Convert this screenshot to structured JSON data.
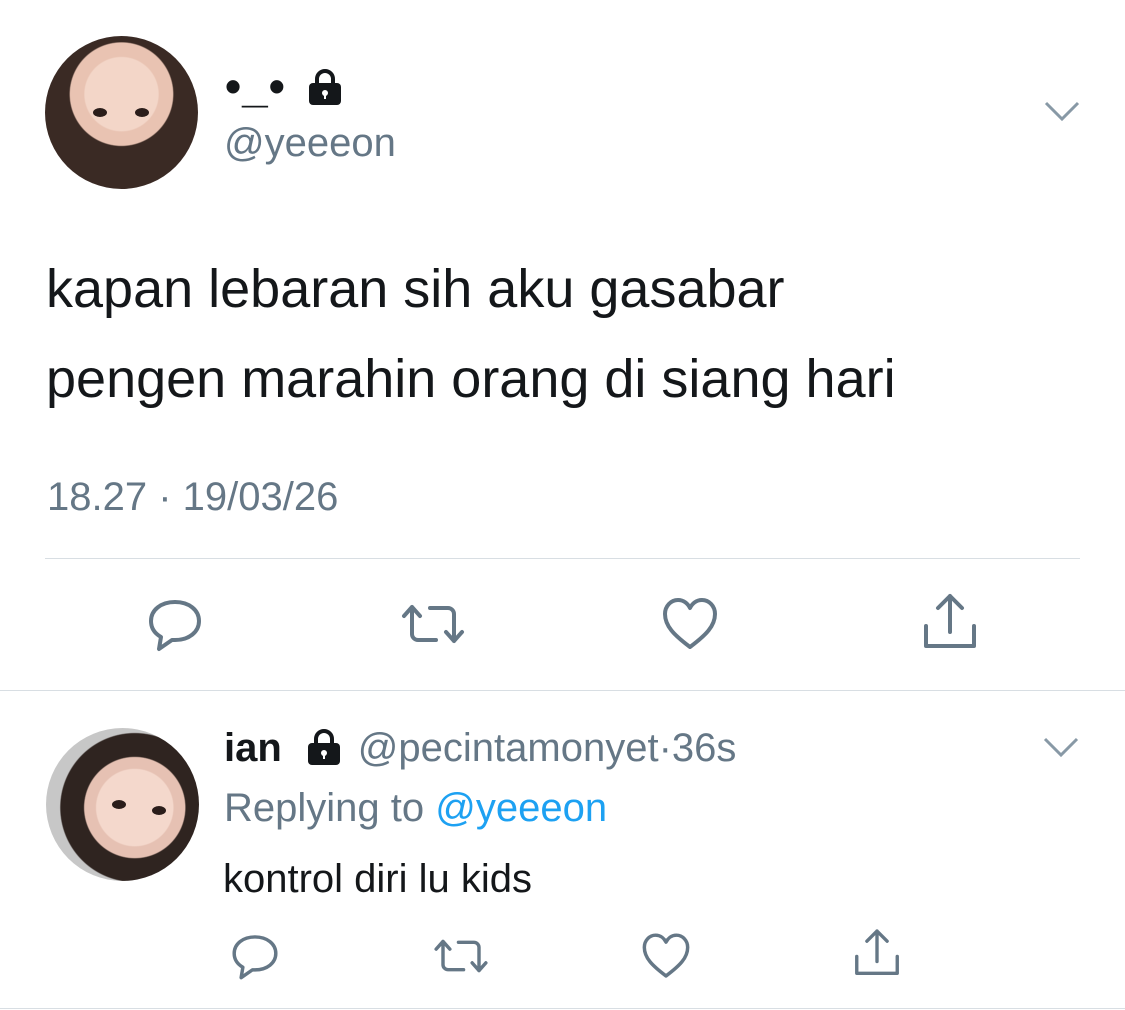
{
  "main_tweet": {
    "display_name": "•_•",
    "handle": "@yeeeon",
    "text_lines": [
      "kapan lebaran sih aku gasabar",
      "pengen marahin orang di siang hari"
    ],
    "timestamp": "18.27 · 19/03/26",
    "icons": {
      "lock": "lock-icon",
      "menu": "chevron-down-icon",
      "reply": "reply-icon",
      "retweet": "retweet-icon",
      "like": "heart-icon",
      "share": "share-icon"
    }
  },
  "reply_tweet": {
    "display_name": "ian",
    "handle": "@pecintamonyet",
    "separator": "·",
    "age": "36s",
    "replying_prefix": "Replying to",
    "replying_handle": "@yeeeon",
    "text": "kontrol diri lu kids",
    "icons": {
      "lock": "lock-icon",
      "menu": "chevron-down-icon",
      "reply": "reply-icon",
      "retweet": "retweet-icon",
      "like": "heart-icon",
      "share": "share-icon"
    }
  },
  "colors": {
    "text": "#14171a",
    "secondary": "#657786",
    "link": "#1da1f2",
    "divider": "#d8dee3",
    "icon": "#657786"
  }
}
